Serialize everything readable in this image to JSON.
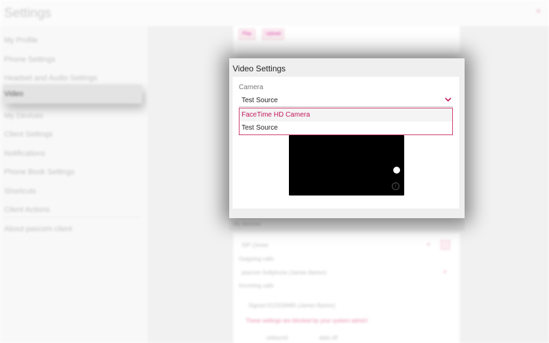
{
  "background": {
    "header": {
      "title": "Settings",
      "close_glyph": "×"
    },
    "sidebar": {
      "items": [
        {
          "label": "My Profile"
        },
        {
          "label": "Phone Settings"
        },
        {
          "label": "Headset and Audio Settings"
        },
        {
          "label": "Video"
        },
        {
          "label": "My Devices"
        },
        {
          "label": "Client Settings"
        },
        {
          "label": "Notifications"
        },
        {
          "label": "Phone Book Settings"
        },
        {
          "label": "Shortcuts"
        },
        {
          "label": "Client Actions"
        },
        {
          "label": "About pascom client"
        }
      ],
      "selected_index": 3
    },
    "main": {
      "chip_play": "Play",
      "chip_upload": "Upload",
      "section_bar": "My devices",
      "lines": {
        "device": "SIP (Jones",
        "outgoing": "Outgoing calls",
        "softphone": "pascom Softphone (James Barton)",
        "incoming": "Incoming calls",
        "forward": "Signed 0123/28485 (James Barton)",
        "blocked": "These settings are blocked by your system admin!",
        "bottom1": "unbound",
        "bottom2": "data off"
      }
    }
  },
  "modal": {
    "title": "Video Settings",
    "camera_label": "Camera",
    "camera_selected": "Test Source",
    "options": [
      "FaceTime HD Camera",
      "Test Source"
    ],
    "highlighted_option_index": 0,
    "info_glyph": "i"
  },
  "colors": {
    "accent": "#c2185b",
    "dropdown_border": "#d0406e",
    "selected_nav": "#d9d9d9",
    "preview": "#000000"
  }
}
